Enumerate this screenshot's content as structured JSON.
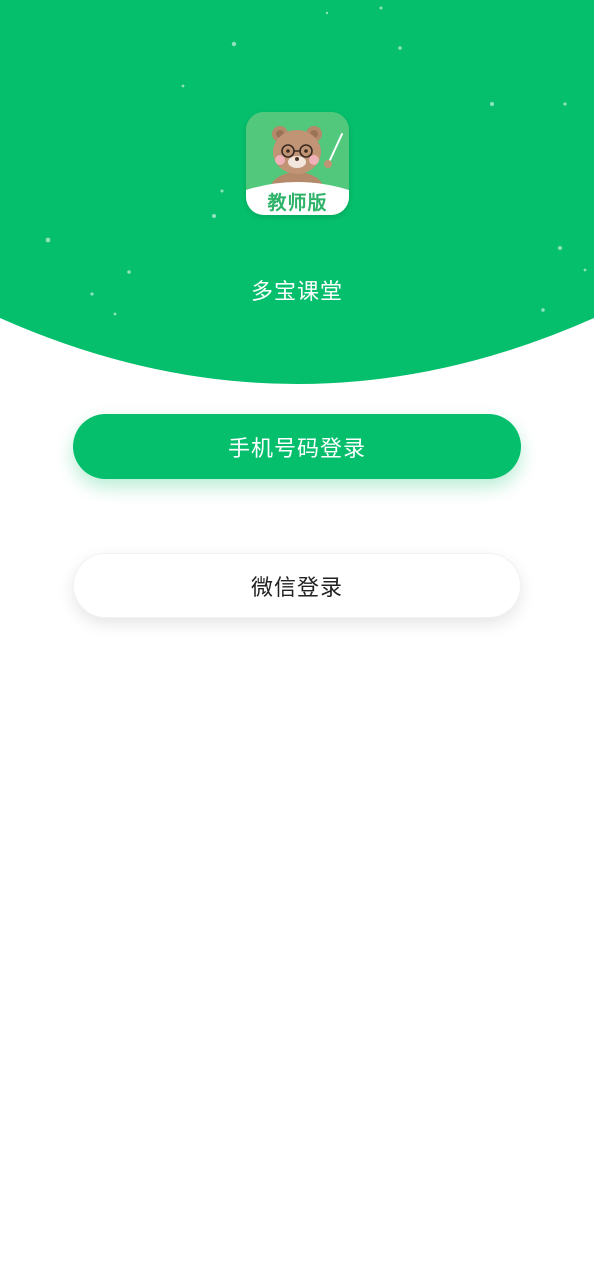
{
  "colors": {
    "primary": "#05bf6c",
    "background": "#ffffff",
    "text_dark": "#222222"
  },
  "header": {
    "app_icon": {
      "icon": "bear-teacher-icon",
      "badge_text": "教师版"
    },
    "app_name": "多宝课堂"
  },
  "login": {
    "phone_button_label": "手机号码登录",
    "wechat_button_label": "微信登录"
  }
}
